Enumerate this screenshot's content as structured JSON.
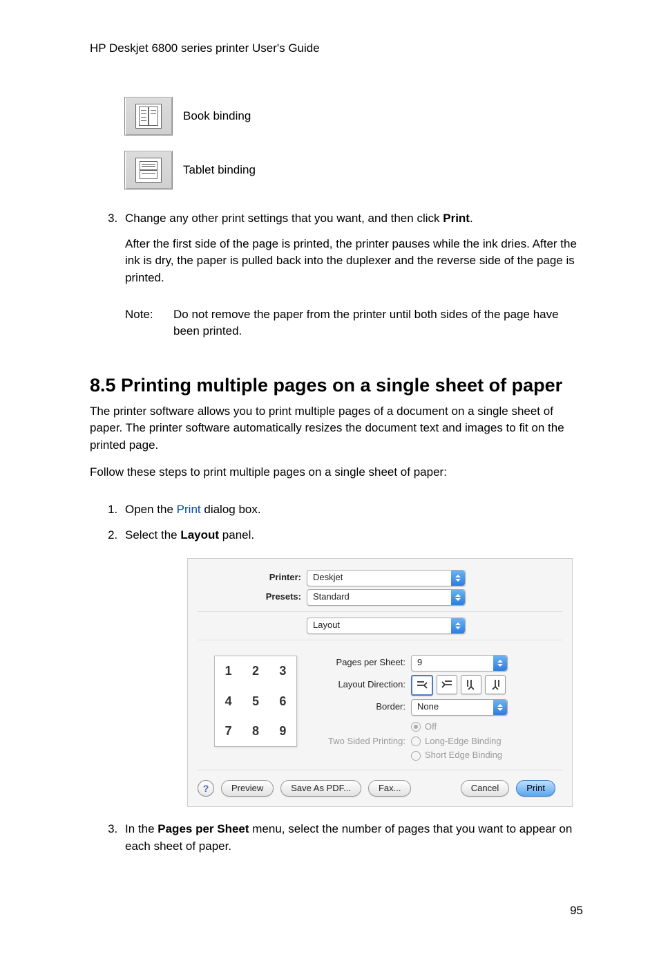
{
  "header": "HP Deskjet 6800 series printer User's Guide",
  "bindings": {
    "book": "Book binding",
    "tablet": "Tablet binding"
  },
  "step3": {
    "num": "3.",
    "text_pre": "Change any other print settings that you want, and then click ",
    "text_bold": "Print",
    "text_post": ".",
    "body": "After the first side of the page is printed, the printer pauses while the ink dries. After the ink is dry, the paper is pulled back into the duplexer and the reverse side of the page is printed.",
    "note_label": "Note:",
    "note_body": "Do not remove the paper from the printer until both sides of the page have been printed."
  },
  "section": {
    "title": "8.5  Printing multiple pages on a single sheet of paper",
    "p1": "The printer software allows you to print multiple pages of a document on a single sheet of paper. The printer software automatically resizes the document text and images to fit on the printed page.",
    "p2": "Follow these steps to print multiple pages on a single sheet of paper:",
    "step1_pre": "Open the ",
    "step1_link": "Print",
    "step1_post": " dialog box.",
    "step2_pre": "Select the ",
    "step2_bold": "Layout",
    "step2_post": " panel.",
    "step3_pre": "In the ",
    "step3_bold": "Pages per Sheet",
    "step3_post": " menu, select the number of pages that you want to appear on each sheet of paper."
  },
  "dialog": {
    "printer_label": "Printer:",
    "printer_value": "Deskjet",
    "presets_label": "Presets:",
    "presets_value": "Standard",
    "panel_value": "Layout",
    "pps_label": "Pages per Sheet:",
    "pps_value": "9",
    "ld_label": "Layout Direction:",
    "border_label": "Border:",
    "border_value": "None",
    "tsp_label": "Two Sided Printing:",
    "radio_off": "Off",
    "radio_long": "Long-Edge Binding",
    "radio_short": "Short Edge Binding",
    "preview_cells": [
      "1",
      "2",
      "3",
      "4",
      "5",
      "6",
      "7",
      "8",
      "9"
    ],
    "help": "?",
    "btn_preview": "Preview",
    "btn_savepdf": "Save As PDF...",
    "btn_fax": "Fax...",
    "btn_cancel": "Cancel",
    "btn_print": "Print"
  },
  "page_number": "95"
}
